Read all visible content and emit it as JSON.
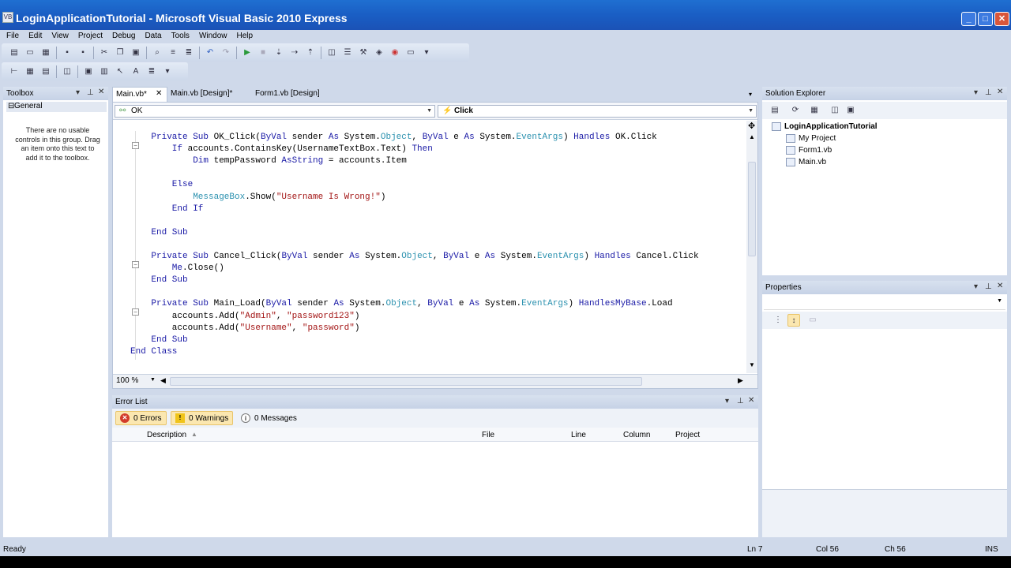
{
  "window": {
    "title": "LoginApplicationTutorial - Microsoft Visual Basic 2010 Express"
  },
  "menu": [
    "File",
    "Edit",
    "View",
    "Project",
    "Debug",
    "Data",
    "Tools",
    "Window",
    "Help"
  ],
  "toolbox": {
    "title": "Toolbox",
    "group": "General",
    "empty_message": "There are no usable controls in this group. Drag an item onto this text to add it to the toolbox."
  },
  "tabs": [
    "Main.vb*",
    "Main.vb [Design]*",
    "Form1.vb [Design]"
  ],
  "editor": {
    "nav_left": "OK",
    "nav_right": "Click",
    "zoom": "100 %",
    "lines": [
      {
        "indent": 0,
        "tokens": []
      },
      {
        "indent": 4,
        "tokens": [
          [
            "kw",
            "Private Sub "
          ],
          [
            "",
            "OK_Click("
          ],
          [
            "kw",
            "ByVal"
          ],
          [
            "",
            " sender "
          ],
          [
            "kw",
            "As"
          ],
          [
            "",
            " System."
          ],
          [
            "ty",
            "Object"
          ],
          [
            "",
            ", "
          ],
          [
            "kw",
            "ByVal"
          ],
          [
            "",
            " e "
          ],
          [
            "kw",
            "As"
          ],
          [
            "",
            " System."
          ],
          [
            "ty",
            "EventArgs"
          ],
          [
            "",
            ") "
          ],
          [
            "kw",
            "Handles"
          ],
          [
            "",
            " OK.Click"
          ]
        ]
      },
      {
        "indent": 8,
        "tokens": [
          [
            "kw",
            "If"
          ],
          [
            "",
            " accounts.ContainsKey(UsernameTextBox.Text) "
          ],
          [
            "kw",
            "Then"
          ]
        ]
      },
      {
        "indent": 12,
        "tokens": [
          [
            "kw",
            "Dim"
          ],
          [
            "",
            " tempPassword "
          ],
          [
            "kw",
            "As"
          ],
          [
            " ",
            ""
          ],
          [
            "kw",
            "String"
          ],
          [
            "",
            " = accounts.Item"
          ]
        ]
      },
      {
        "indent": 0,
        "tokens": []
      },
      {
        "indent": 8,
        "tokens": [
          [
            "kw",
            "Else"
          ]
        ]
      },
      {
        "indent": 12,
        "tokens": [
          [
            "ty",
            "MessageBox"
          ],
          [
            "",
            ".Show("
          ],
          [
            "st",
            "\"Username Is Wrong!\""
          ],
          [
            "",
            ")"
          ]
        ]
      },
      {
        "indent": 8,
        "tokens": [
          [
            "kw",
            "End If"
          ]
        ]
      },
      {
        "indent": 0,
        "tokens": []
      },
      {
        "indent": 4,
        "tokens": [
          [
            "kw",
            "End Sub"
          ]
        ]
      },
      {
        "indent": 0,
        "tokens": []
      },
      {
        "indent": 4,
        "tokens": [
          [
            "kw",
            "Private Sub "
          ],
          [
            "",
            "Cancel_Click("
          ],
          [
            "kw",
            "ByVal"
          ],
          [
            "",
            " sender "
          ],
          [
            "kw",
            "As"
          ],
          [
            "",
            " System."
          ],
          [
            "ty",
            "Object"
          ],
          [
            "",
            ", "
          ],
          [
            "kw",
            "ByVal"
          ],
          [
            "",
            " e "
          ],
          [
            "kw",
            "As"
          ],
          [
            "",
            " System."
          ],
          [
            "ty",
            "EventArgs"
          ],
          [
            "",
            ") "
          ],
          [
            "kw",
            "Handles"
          ],
          [
            "",
            " Cancel.Click"
          ]
        ]
      },
      {
        "indent": 8,
        "tokens": [
          [
            "kw",
            "Me"
          ],
          [
            "",
            ".Close()"
          ]
        ]
      },
      {
        "indent": 4,
        "tokens": [
          [
            "kw",
            "End Sub"
          ]
        ]
      },
      {
        "indent": 0,
        "tokens": []
      },
      {
        "indent": 4,
        "tokens": [
          [
            "kw",
            "Private Sub "
          ],
          [
            "",
            "Main_Load("
          ],
          [
            "kw",
            "ByVal"
          ],
          [
            "",
            " sender "
          ],
          [
            "kw",
            "As"
          ],
          [
            "",
            " System."
          ],
          [
            "ty",
            "Object"
          ],
          [
            "",
            ", "
          ],
          [
            "kw",
            "ByVal"
          ],
          [
            "",
            " e "
          ],
          [
            "kw",
            "As"
          ],
          [
            "",
            " System."
          ],
          [
            "ty",
            "EventArgs"
          ],
          [
            "",
            ") "
          ],
          [
            "kw",
            "Handles"
          ],
          [
            " ",
            ""
          ],
          [
            "kw",
            "MyBase"
          ],
          [
            "",
            ".Load"
          ]
        ]
      },
      {
        "indent": 8,
        "tokens": [
          [
            "",
            "accounts.Add("
          ],
          [
            "st",
            "\"Admin\""
          ],
          [
            "",
            ", "
          ],
          [
            "st",
            "\"password123\""
          ],
          [
            "",
            ")"
          ]
        ]
      },
      {
        "indent": 8,
        "tokens": [
          [
            "",
            "accounts.Add("
          ],
          [
            "st",
            "\"Username\""
          ],
          [
            "",
            ", "
          ],
          [
            "st",
            "\"password\""
          ],
          [
            "",
            ")"
          ]
        ]
      },
      {
        "indent": 4,
        "tokens": [
          [
            "kw",
            "End Sub"
          ]
        ]
      },
      {
        "indent": 0,
        "tokens": [
          [
            "kw",
            "End Class"
          ]
        ]
      }
    ]
  },
  "solution_explorer": {
    "title": "Solution Explorer",
    "items": [
      {
        "label": "LoginApplicationTutorial",
        "level": 0,
        "bold": true
      },
      {
        "label": "My Project",
        "level": 1
      },
      {
        "label": "Form1.vb",
        "level": 1
      },
      {
        "label": "Main.vb",
        "level": 1
      }
    ]
  },
  "properties": {
    "title": "Properties"
  },
  "error_list": {
    "title": "Error List",
    "errors": "0 Errors",
    "warnings": "0 Warnings",
    "messages": "0 Messages",
    "columns": [
      "Description",
      "File",
      "Line",
      "Column",
      "Project"
    ]
  },
  "status": {
    "left": "Ready",
    "ln": "Ln 7",
    "col": "Col 56",
    "ch": "Ch 56",
    "mode": "INS"
  }
}
